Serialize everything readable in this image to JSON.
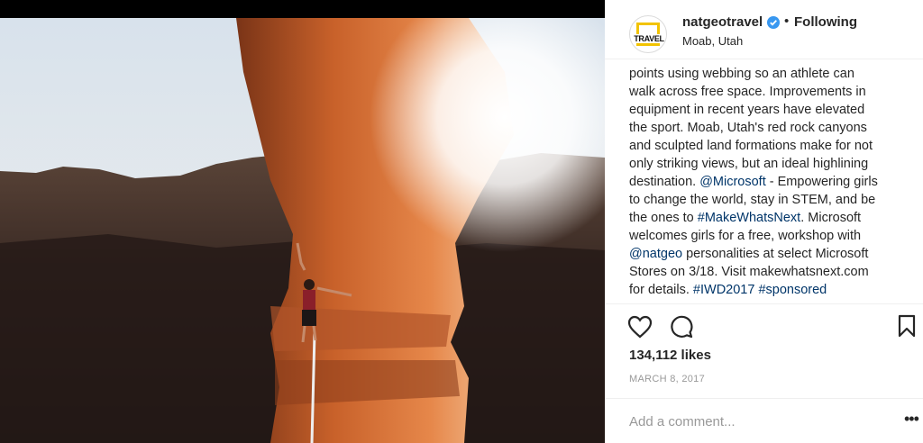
{
  "post": {
    "username": "natgeotravel",
    "separator": "•",
    "follow_status": "Following",
    "location": "Moab, Utah",
    "avatar_text": "TRAVEL",
    "verified_icon": "verified-badge-icon",
    "caption_lines": [
      [
        {
          "t": "points using webbing so an athlete can"
        }
      ],
      [
        {
          "t": "walk across free space. Improvements in"
        }
      ],
      [
        {
          "t": "equipment in recent years have elevated"
        }
      ],
      [
        {
          "t": "the sport. Moab, Utah's red rock canyons"
        }
      ],
      [
        {
          "t": "and sculpted land formations make for not"
        }
      ],
      [
        {
          "t": "only striking views, but an ideal highlining"
        }
      ],
      [
        {
          "t": "destination. "
        },
        {
          "t": "@Microsoft",
          "link": true
        },
        {
          "t": " - Empowering girls"
        }
      ],
      [
        {
          "t": "to change the world, stay in STEM, and be"
        }
      ],
      [
        {
          "t": "the ones to "
        },
        {
          "t": "#MakeWhatsNext",
          "link": true
        },
        {
          "t": ". Microsoft"
        }
      ],
      [
        {
          "t": "welcomes girls for a free, workshop with"
        }
      ],
      [
        {
          "t": "@natgeo",
          "link": true
        },
        {
          "t": " personalities at select Microsoft"
        }
      ],
      [
        {
          "t": "Stores on 3/18. Visit makewhatsnext.com"
        }
      ],
      [
        {
          "t": "for details. "
        },
        {
          "t": "#IWD2017",
          "link": true
        },
        {
          "t": " "
        },
        {
          "t": "#sponsored",
          "link": true
        }
      ]
    ],
    "likes": "134,112 likes",
    "date": "MARCH 8, 2017",
    "comment_placeholder": "Add a comment...",
    "more_label": "•••"
  },
  "icons": {
    "like": "heart-icon",
    "comment": "comment-icon",
    "save": "bookmark-icon"
  },
  "colors": {
    "link": "#003569",
    "text": "#262626",
    "muted": "#999999",
    "verified": "#3897f0"
  }
}
